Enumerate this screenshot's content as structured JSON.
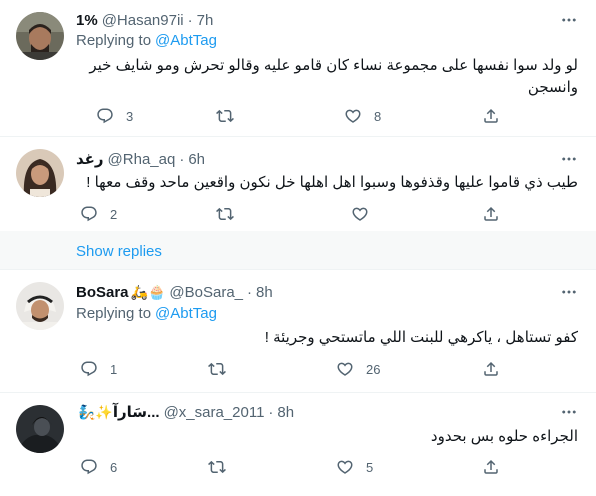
{
  "tweets": [
    {
      "name": "1%",
      "handle": "@Hasan97ii",
      "sep": "·",
      "time": "7h",
      "replying_prefix": "Replying to",
      "replying_to": "@AbtTag",
      "text": "لو ولد سوا نفسها على مجموعة نساء كان قامو عليه وقالو تحرش ومو شايف خير وانسجن",
      "replies": "3",
      "retweets": "",
      "likes": "8"
    },
    {
      "name": "رغد",
      "handle": "@Rha_aq",
      "sep": "·",
      "time": "6h",
      "text": "طيب ذي قاموا عليها وقذفوها وسبوا اهل اهلها خل نكون واقعين ماحد وقف معها !",
      "replies": "2",
      "retweets": "",
      "likes": ""
    },
    {
      "name": "BoSara",
      "name_emoji": "🛵🧁",
      "handle": "@BoSara_",
      "sep": "·",
      "time": "8h",
      "replying_prefix": "Replying to",
      "replying_to": "@AbtTag",
      "text": "كفو تستاهل ، ياكرهي للبنت اللي ماتستحي وجريئة !",
      "replies": "1",
      "retweets": "",
      "likes": "26"
    },
    {
      "name": "سَارآ...",
      "name_emoji": "🧞✨",
      "handle": "@x_sara_2011",
      "sep": "·",
      "time": "8h",
      "text": "الجراءه حلوه بس بحدود",
      "replies": "6",
      "retweets": "",
      "likes": "5"
    }
  ],
  "show_replies": "Show replies",
  "icons": {
    "reply": "reply-icon",
    "retweet": "retweet-icon",
    "like": "heart-icon",
    "share": "share-icon",
    "more": "more-icon"
  },
  "colors": {
    "accent": "#1d9bf0",
    "secondary_text": "#536471",
    "divider": "#eff3f4"
  }
}
